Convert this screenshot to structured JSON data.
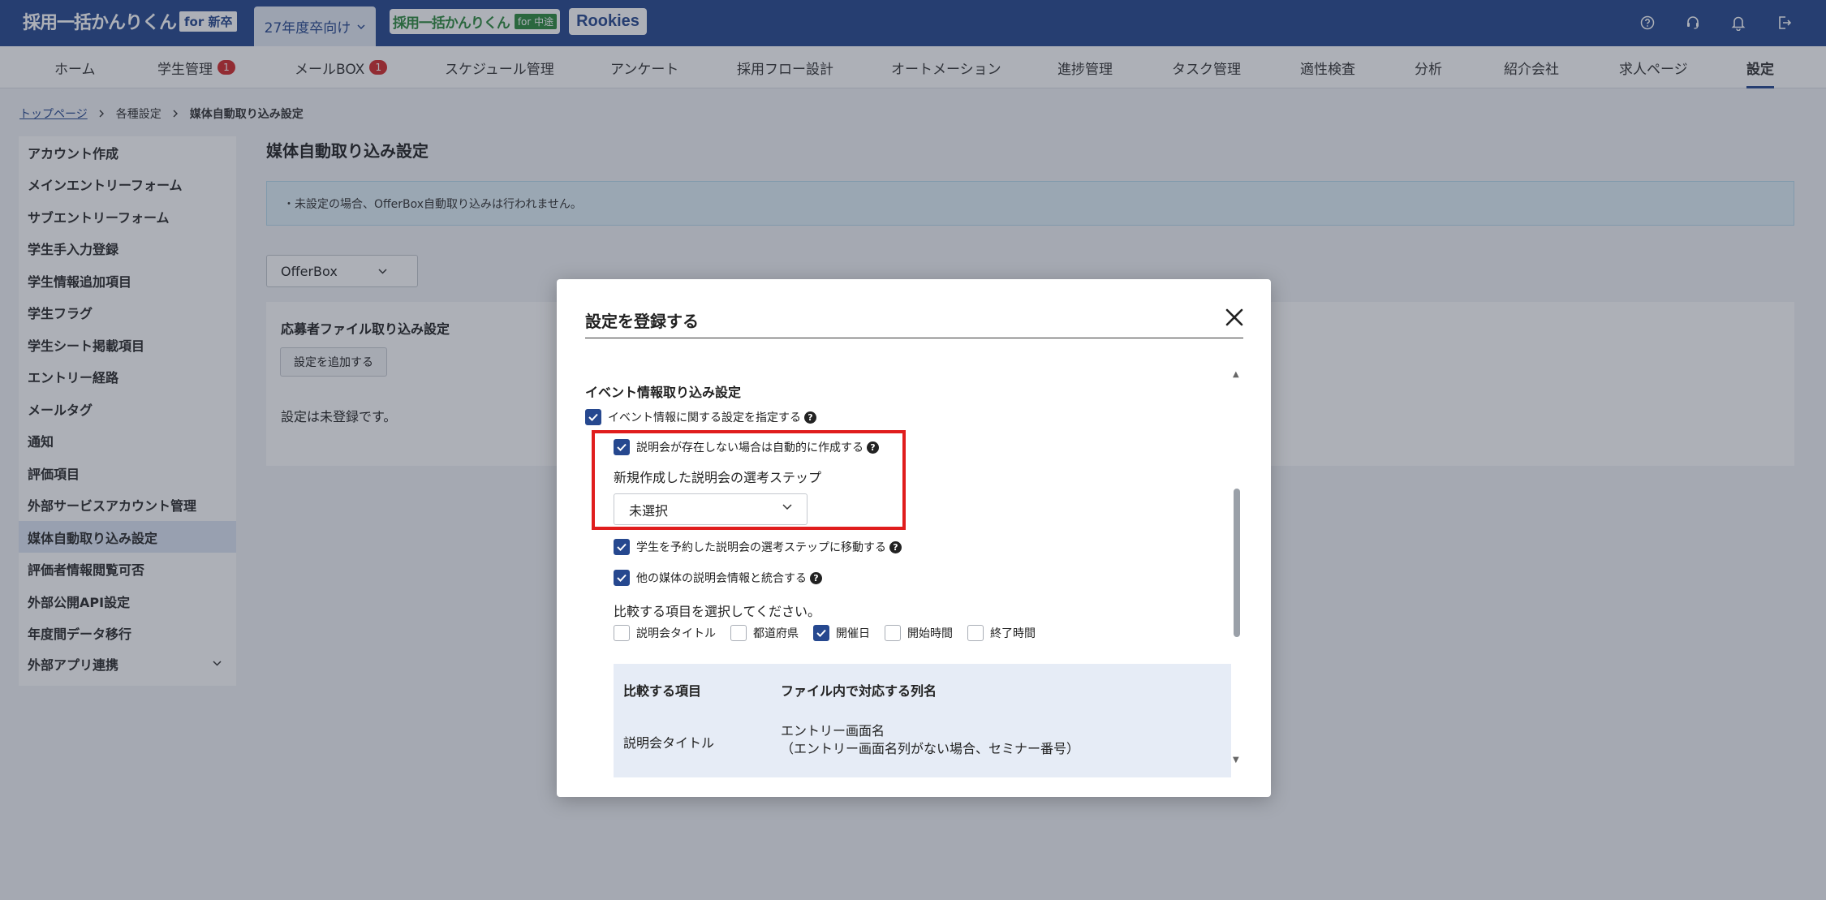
{
  "header": {
    "logo_text": "採用一括かんりくん",
    "logo_badge": "for 新卒",
    "year_tab": "27年度卒向け",
    "chuto_logo_text": "採用一括かんりくん",
    "chuto_logo_badge": "for 中途",
    "rookies_logo": "Rookies",
    "icons": [
      "help-icon",
      "support-icon",
      "bell-icon",
      "logout-icon"
    ]
  },
  "nav": {
    "items": [
      {
        "label": "ホーム"
      },
      {
        "label": "学生管理",
        "badge": "1"
      },
      {
        "label": "メールBOX",
        "badge": "1"
      },
      {
        "label": "スケジュール管理"
      },
      {
        "label": "アンケート"
      },
      {
        "label": "採用フロー設計"
      },
      {
        "label": "オートメーション"
      },
      {
        "label": "進捗管理"
      },
      {
        "label": "タスク管理"
      },
      {
        "label": "適性検査"
      },
      {
        "label": "分析"
      },
      {
        "label": "紹介会社"
      },
      {
        "label": "求人ページ"
      },
      {
        "label": "設定",
        "active": true
      }
    ]
  },
  "breadcrumb": {
    "top": "トップページ",
    "middle": "各種設定",
    "current": "媒体自動取り込み設定"
  },
  "sidebar": {
    "items": [
      {
        "label": "アカウント作成"
      },
      {
        "label": "メインエントリーフォーム"
      },
      {
        "label": "サブエントリーフォーム"
      },
      {
        "label": "学生手入力登録"
      },
      {
        "label": "学生情報追加項目"
      },
      {
        "label": "学生フラグ"
      },
      {
        "label": "学生シート掲載項目"
      },
      {
        "label": "エントリー経路"
      },
      {
        "label": "メールタグ"
      },
      {
        "label": "通知"
      },
      {
        "label": "評価項目"
      },
      {
        "label": "外部サービスアカウント管理"
      },
      {
        "label": "媒体自動取り込み設定",
        "active": true
      },
      {
        "label": "評価者情報閲覧可否"
      },
      {
        "label": "外部公開API設定"
      },
      {
        "label": "年度間データ移行"
      },
      {
        "label": "外部アプリ連携",
        "expandable": true
      }
    ]
  },
  "main": {
    "title": "媒体自動取り込み設定",
    "info": "・未設定の場合、OfferBox自動取り込みは行われません。",
    "media_select": "OfferBox",
    "panel_title": "応募者ファイル取り込み設定",
    "add_button": "設定を追加する",
    "empty_text": "設定は未登録です。"
  },
  "modal": {
    "title": "設定を登録する",
    "section_title": "イベント情報取り込み設定",
    "event_setting_checkbox": "イベント情報に関する設定を指定する",
    "auto_create_checkbox": "説明会が存在しない場合は自動的に作成する",
    "step_label": "新規作成した説明会の選考ステップ",
    "step_select_value": "未選択",
    "move_step_checkbox": "学生を予約した説明会の選考ステップに移動する",
    "merge_checkbox": "他の媒体の説明会情報と統合する",
    "compare_prompt": "比較する項目を選択してください。",
    "compare_options": [
      {
        "label": "説明会タイトル",
        "checked": false
      },
      {
        "label": "都道府県",
        "checked": false
      },
      {
        "label": "開催日",
        "checked": true
      },
      {
        "label": "開始時間",
        "checked": false
      },
      {
        "label": "終了時間",
        "checked": false
      }
    ],
    "table": {
      "header_item": "比較する項目",
      "header_column": "ファイル内で対応する列名",
      "row_item": "説明会タイトル",
      "row_column_line1": "エントリー画面名",
      "row_column_line2": "（エントリー画面名列がない場合、セミナー番号）"
    }
  },
  "colors": {
    "brand": "#26488f",
    "highlight": "#e01d1d",
    "badge": "#d42a2a"
  }
}
